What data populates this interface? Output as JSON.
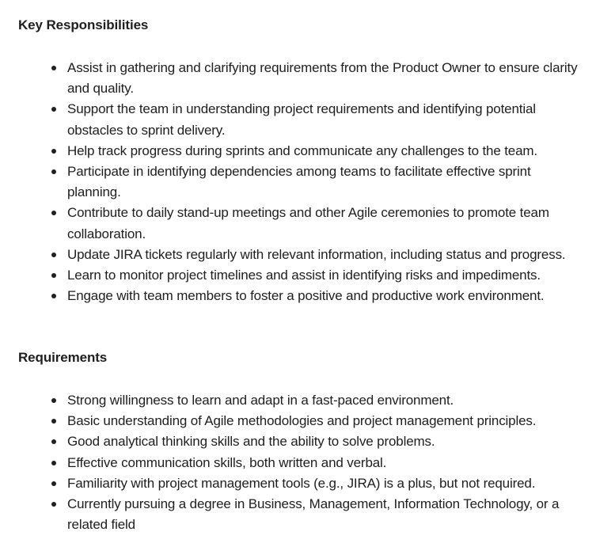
{
  "sections": [
    {
      "heading": "Key Responsibilities",
      "items": [
        "Assist in gathering and clarifying requirements from the Product Owner to ensure clarity and quality.",
        "Support the team in understanding project requirements and identifying potential obstacles to sprint delivery.",
        "Help track progress during sprints and communicate any challenges to the team.",
        "Participate in identifying dependencies among teams to facilitate effective sprint planning.",
        "Contribute to daily stand-up meetings and other Agile ceremonies to promote team collaboration.",
        "Update JIRA tickets regularly with relevant information, including status and progress.",
        "Learn to monitor project timelines and assist in identifying risks and impediments.",
        "Engage with team members to foster a positive and productive work environment."
      ]
    },
    {
      "heading": "Requirements",
      "items": [
        "Strong willingness to learn and adapt in a fast-paced environment.",
        "Basic understanding of Agile methodologies and project management principles.",
        "Good analytical thinking skills and the ability to solve problems.",
        "Effective communication skills, both written and verbal.",
        "Familiarity with project management tools (e.g., JIRA) is a plus, but not required.",
        "Currently pursuing a degree in Business, Management, Information Technology, or a related field"
      ]
    }
  ]
}
